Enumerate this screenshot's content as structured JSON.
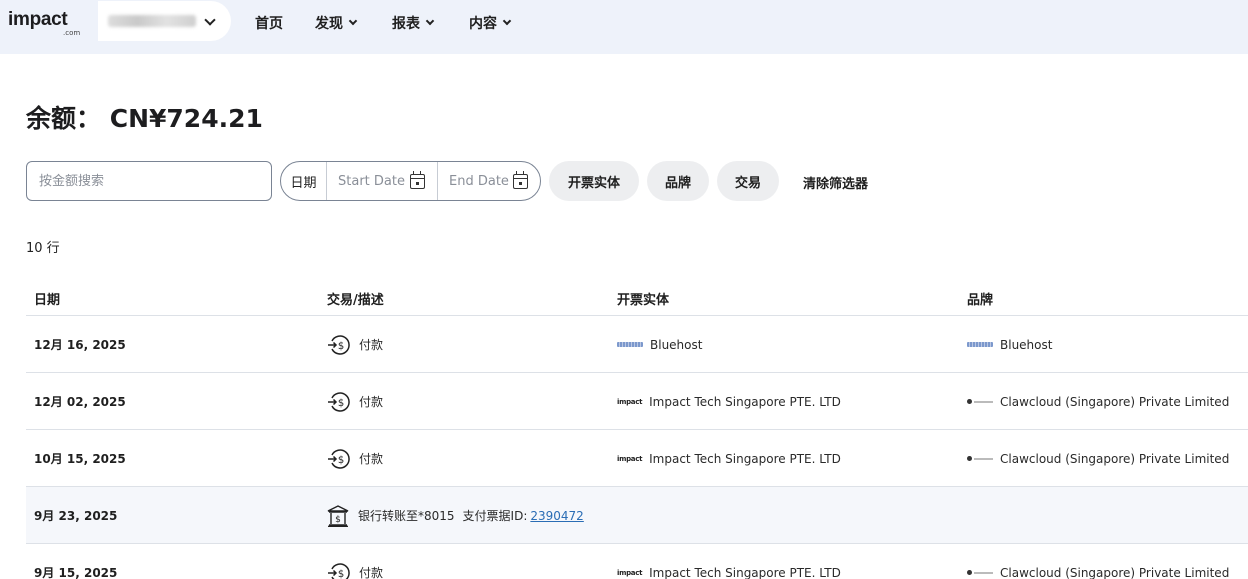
{
  "header": {
    "logo_text": "impact",
    "logo_sub": ".com",
    "nav": [
      {
        "label": "首页",
        "has_dropdown": false
      },
      {
        "label": "发现",
        "has_dropdown": true
      },
      {
        "label": "报表",
        "has_dropdown": true
      },
      {
        "label": "内容",
        "has_dropdown": true
      }
    ]
  },
  "balance": {
    "label": "余额：",
    "amount": "CN¥724.21"
  },
  "filters": {
    "search_placeholder": "按金额搜索",
    "date_label": "日期",
    "start_date_placeholder": "Start Date",
    "end_date_placeholder": "End Date",
    "buttons": [
      "开票实体",
      "品牌",
      "交易"
    ],
    "clear_label": "清除筛选器"
  },
  "row_count": "10 行",
  "table": {
    "columns": [
      "日期",
      "交易/描述",
      "开票实体",
      "品牌"
    ],
    "rows": [
      {
        "date": "12月 16, 2025",
        "type": "payment",
        "description": "付款",
        "entity": "Bluehost",
        "entity_logo": "bluehost-logo",
        "brand": "Bluehost",
        "brand_logo": "bluehost-logo"
      },
      {
        "date": "12月 02, 2025",
        "type": "payment",
        "description": "付款",
        "entity": "Impact Tech Singapore PTE. LTD",
        "entity_logo": "impact-logo",
        "brand": "Clawcloud (Singapore) Private Limited",
        "brand_logo": "clawcloud-logo"
      },
      {
        "date": "10月 15, 2025",
        "type": "payment",
        "description": "付款",
        "entity": "Impact Tech Singapore PTE. LTD",
        "entity_logo": "impact-logo",
        "brand": "Clawcloud (Singapore) Private Limited",
        "brand_logo": "clawcloud-logo"
      },
      {
        "date": "9月 23, 2025",
        "type": "bank-transfer",
        "description": "银行转账至*8015",
        "invoice_label": "支付票据ID:",
        "invoice_id": "2390472",
        "entity": "",
        "brand": ""
      },
      {
        "date": "9月 15, 2025",
        "type": "payment",
        "description": "付款",
        "entity": "Impact Tech Singapore PTE. LTD",
        "entity_logo": "impact-logo",
        "brand": "Clawcloud (Singapore) Private Limited",
        "brand_logo": "clawcloud-logo"
      }
    ]
  },
  "colors": {
    "topbar_bg": "#eef2fa",
    "pill_bg": "#edeef0",
    "alt_row_bg": "#f5f7fb",
    "link": "#2a6db5"
  }
}
